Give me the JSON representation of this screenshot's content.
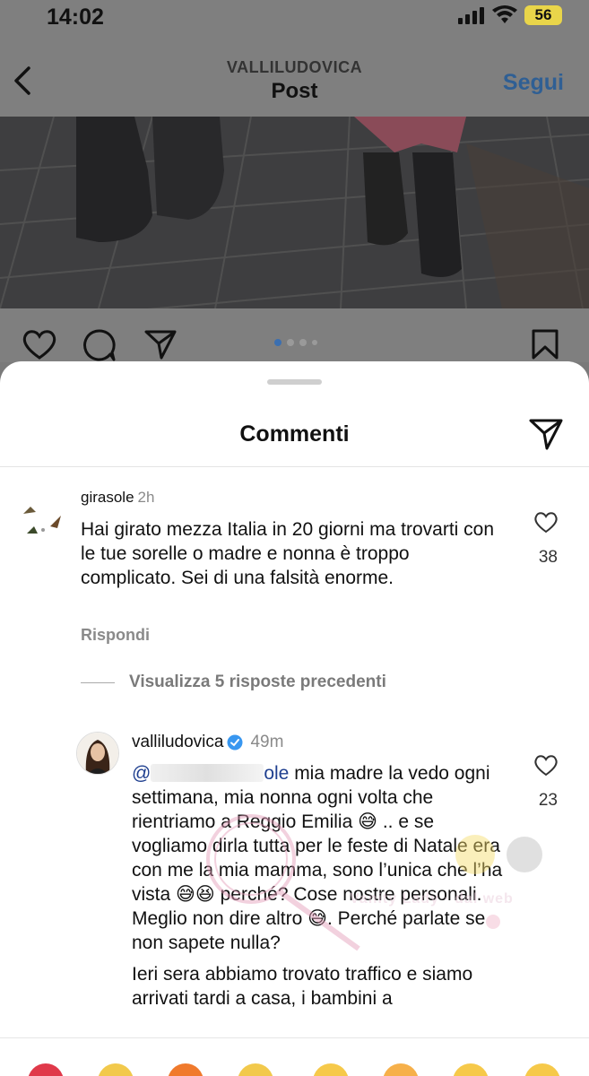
{
  "status_bar": {
    "time": "14:02",
    "battery": "56"
  },
  "header": {
    "username": "VALLILUDOVICA",
    "title": "Post",
    "follow_label": "Segui"
  },
  "sheet": {
    "title": "Commenti",
    "comments": [
      {
        "username": "girasole",
        "time": "2h",
        "text": "Hai girato mezza Italia in 20 giorni ma trovarti con le tue sorelle o madre e nonna è troppo complicato. Sei di una falsità enorme.",
        "likes": "38",
        "reply_label": "Rispondi"
      },
      {
        "username": "valliludovica",
        "time": "49m",
        "verified": true,
        "mention_suffix": "ole",
        "text_1": " mia madre la vedo ogni settimana, mia nonna ogni volta che rientriamo a Reggio Emilia 😅 .. e se vogliamo dirla tutta per le feste di Natale era con me la mia mamma, sono l’unica che l’ha vista 😅😆 perché? Cose nostre personali. Meglio non dire altro 😅. Perché parlate se non sapete nulla?",
        "text_2": "Ieri sera abbiamo trovato traffico e siamo arrivati tardi a casa, i bambini a",
        "likes": "23"
      }
    ],
    "view_replies_label": "Visualizza 5 risposte precedenti"
  },
  "watermark_text": "Vanity Lady · dal web",
  "emoji_bar": [
    "❤️",
    "🙌",
    "🔥",
    "👏",
    "😢",
    "😍",
    "😮",
    "😂"
  ],
  "colors": {
    "follow": "#2f5f94",
    "accent_dot": "#3b6fb0",
    "overlay": "#7f7f7f",
    "verified": "#3897f0"
  }
}
